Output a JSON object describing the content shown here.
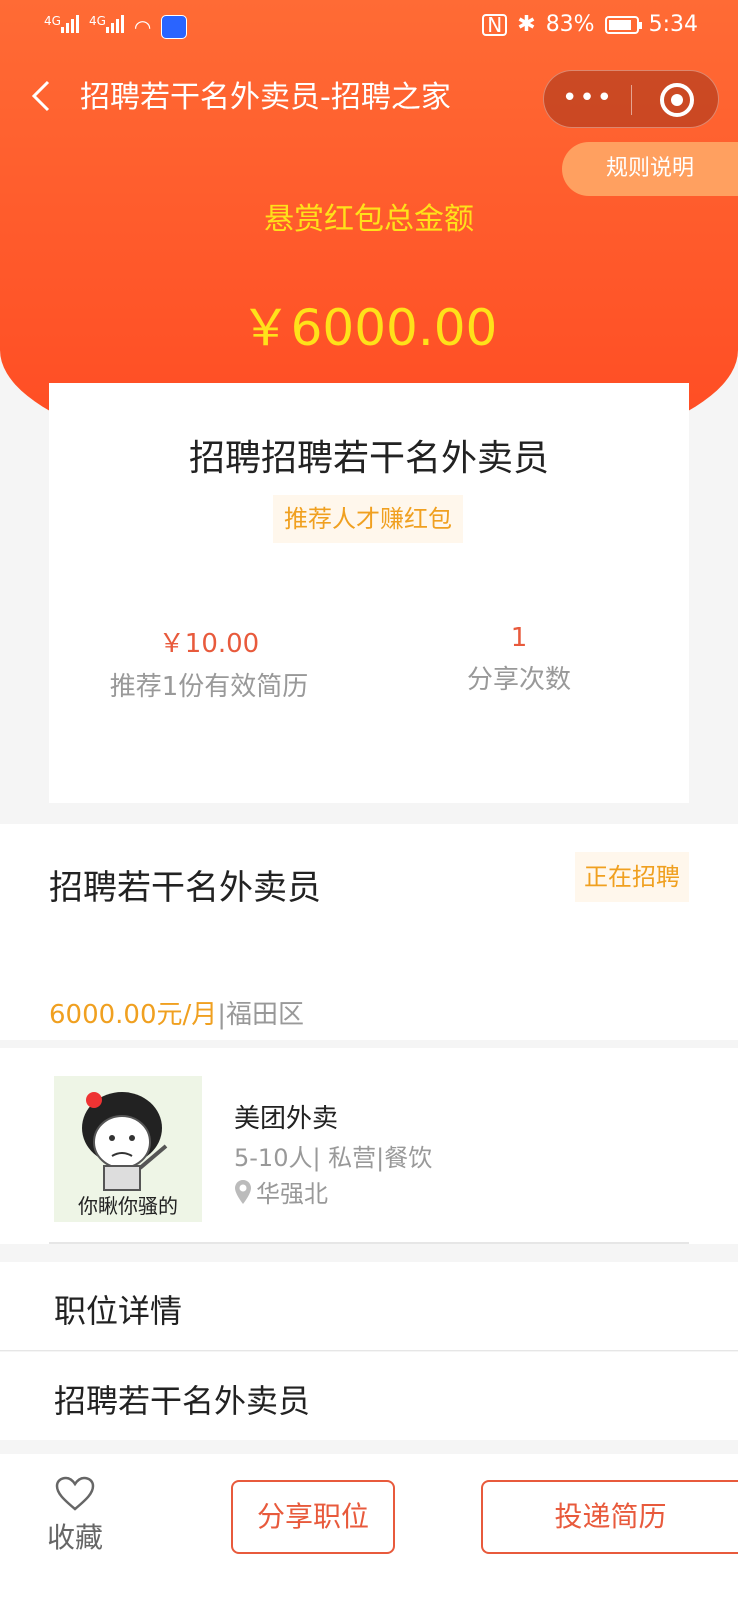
{
  "status_bar": {
    "signal1_label": "4G",
    "signal2_label": "4G",
    "battery_percent": "83%",
    "time": "5:34"
  },
  "nav": {
    "title": "招聘若干名外卖员-招聘之家"
  },
  "header": {
    "rules_label": "规则说明",
    "reward_title": "悬赏红包总金额",
    "reward_amount": "￥6000.00"
  },
  "reward_card": {
    "job_title": "招聘招聘若干名外卖员",
    "tag": "推荐人才赚红包",
    "stats": [
      {
        "value": "￥10.00",
        "label": "推荐1份有效简历"
      },
      {
        "value": "1",
        "label": "分享次数"
      }
    ]
  },
  "job": {
    "title": "招聘若干名外卖员",
    "status": "正在招聘",
    "salary": "6000.00元/月",
    "separator": "|",
    "area": "福田区"
  },
  "company": {
    "logo_caption": "你瞅你骚的",
    "name": "美团外卖",
    "info": "5-10人| 私营|餐饮",
    "location": "华强北"
  },
  "details": {
    "section_title": "职位详情",
    "content": "招聘若干名外卖员"
  },
  "bottom_bar": {
    "favorite_label": "收藏",
    "share_label": "分享职位",
    "apply_label": "投递简历"
  }
}
